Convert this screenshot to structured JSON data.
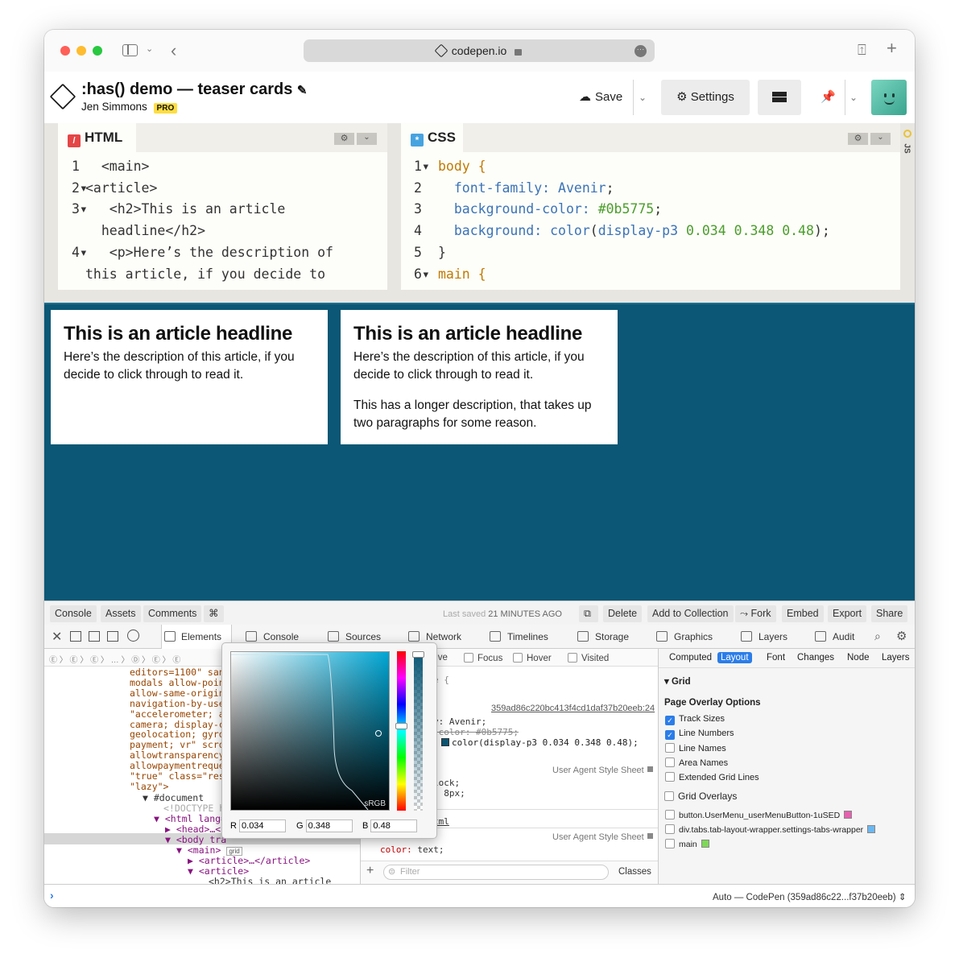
{
  "browser": {
    "url": "codepen.io"
  },
  "pen": {
    "title": ":has() demo — teaser cards",
    "author": "Jen Simmons",
    "badge": "PRO"
  },
  "header_buttons": {
    "save": "Save",
    "settings": "Settings"
  },
  "editors": {
    "html": {
      "label": "HTML",
      "lines": [
        {
          "n": "1",
          "text": "  <main>"
        },
        {
          "n": "2▾",
          "text": "<article>"
        },
        {
          "n": "3▾",
          "text": "   <h2>This is an article"
        },
        {
          "n": "",
          "text": "  headline</h2>"
        },
        {
          "n": "4▾",
          "text": "   <p>Here’s the description of"
        },
        {
          "n": "",
          "text": "this article, if you decide to"
        }
      ]
    },
    "css": {
      "label": "CSS",
      "lines": [
        {
          "n": "1▾",
          "sel": "body {",
          "prop": "",
          "val": ""
        },
        {
          "n": "2",
          "sel": "",
          "prop": "  font-family:",
          "val": " Avenir;"
        },
        {
          "n": "3",
          "sel": "",
          "prop": "  background-color:",
          "val": " #0b5775;"
        },
        {
          "n": "4",
          "sel": "",
          "prop": "  background:",
          "val": " color(display-p3 0.034 0.348 0.48);"
        },
        {
          "n": "5",
          "sel": "}",
          "prop": "",
          "val": ""
        },
        {
          "n": "6▾",
          "sel": "main {",
          "prop": "",
          "val": ""
        }
      ]
    },
    "js_label": "JS"
  },
  "cards": [
    {
      "headline": "This is an article headline",
      "p1": "Here’s the description of this article, if you decide to click through to read it.",
      "p2": ""
    },
    {
      "headline": "This is an article headline",
      "p1": "Here’s the description of this article, if you decide to click through to read it.",
      "p2": "This has a longer description, that takes up two paragraphs for some reason."
    }
  ],
  "bottom_bar": {
    "console": "Console",
    "assets": "Assets",
    "comments": "Comments",
    "shortcut": "⌘",
    "last_saved_prefix": "Last saved",
    "last_saved_time": "21 MINUTES AGO",
    "delete": "Delete",
    "add": "Add to Collection",
    "fork": "Fork",
    "embed": "Embed",
    "export": "Export",
    "share": "Share"
  },
  "devtools": {
    "tabs": [
      "Elements",
      "Console",
      "Sources",
      "Network",
      "Timelines",
      "Storage",
      "Graphics",
      "Layers",
      "Audit"
    ],
    "dom_lines": [
      "editors=1100\" sand",
      "modals allow-point",
      "allow-same-origin",
      "navigation-by-user",
      "\"accelerometer; am",
      "camera; display-ca",
      "geolocation; gyros",
      "payment; vr\" scrol",
      "allowtransparency=",
      "allowpaymentreques",
      "\"true\" class=\"resu",
      "\"lazy\">"
    ],
    "dom_doc": "▼ #document",
    "dom_doctype": "<!DOCTYPE h",
    "dom_html": "▼ <html lang=",
    "dom_head": "▶ <head>…</",
    "dom_body": "▼ <body tra",
    "dom_main": "▼ <main>",
    "dom_grid": "grid",
    "dom_article1": "▶ <article>…</article>",
    "dom_article2": "▼ <article>",
    "dom_h2": "<h2>This is an article",
    "styles": {
      "pseudo": [
        "tive",
        "Focus",
        "Hover",
        "Visited"
      ],
      "rule_open": "e {",
      "source": "359ad86c220bc413f4cd1daf37b20eeb:24",
      "prop1": "y: Avenir;",
      "prop2": "-color: #0b5775;",
      "prop3": "color(display-p3 0.034 0.348 0.48);",
      "ua1": "User Agent Style Sheet",
      "ua_props": [
        "lock;",
        ": 8px;"
      ],
      "html_link": "tml",
      "ua2": "User Agent Style Sheet",
      "color_prop": "color:",
      "color_val": " text;",
      "filter": "Filter",
      "classes": "Classes"
    },
    "picker": {
      "gamut": "sRGB",
      "r_label": "R",
      "r": "0.034",
      "g_label": "G",
      "g": "0.348",
      "b_label": "B",
      "b": "0.48"
    },
    "layout": {
      "tabs": [
        "Computed",
        "Layout",
        "Font",
        "Changes",
        "Node",
        "Layers"
      ],
      "active_tab": "Layout",
      "grid": "Grid",
      "overlay_options": "Page Overlay Options",
      "options": [
        {
          "label": "Track Sizes",
          "checked": true
        },
        {
          "label": "Line Numbers",
          "checked": true
        },
        {
          "label": "Line Names",
          "checked": false
        },
        {
          "label": "Area Names",
          "checked": false
        },
        {
          "label": "Extended Grid Lines",
          "checked": false
        }
      ],
      "overlays_title": "Grid Overlays",
      "overlays": [
        {
          "label": "button.UserMenu_userMenuButton-1uSED",
          "color": "#e85fb0"
        },
        {
          "label": "div.tabs.tab-layout-wrapper.settings-tabs-wrapper",
          "color": "#6bb7f0"
        },
        {
          "label": "main",
          "color": "#7ed957"
        }
      ]
    },
    "console_context": "Auto — CodePen (359ad86c22...f37b20eeb)"
  }
}
